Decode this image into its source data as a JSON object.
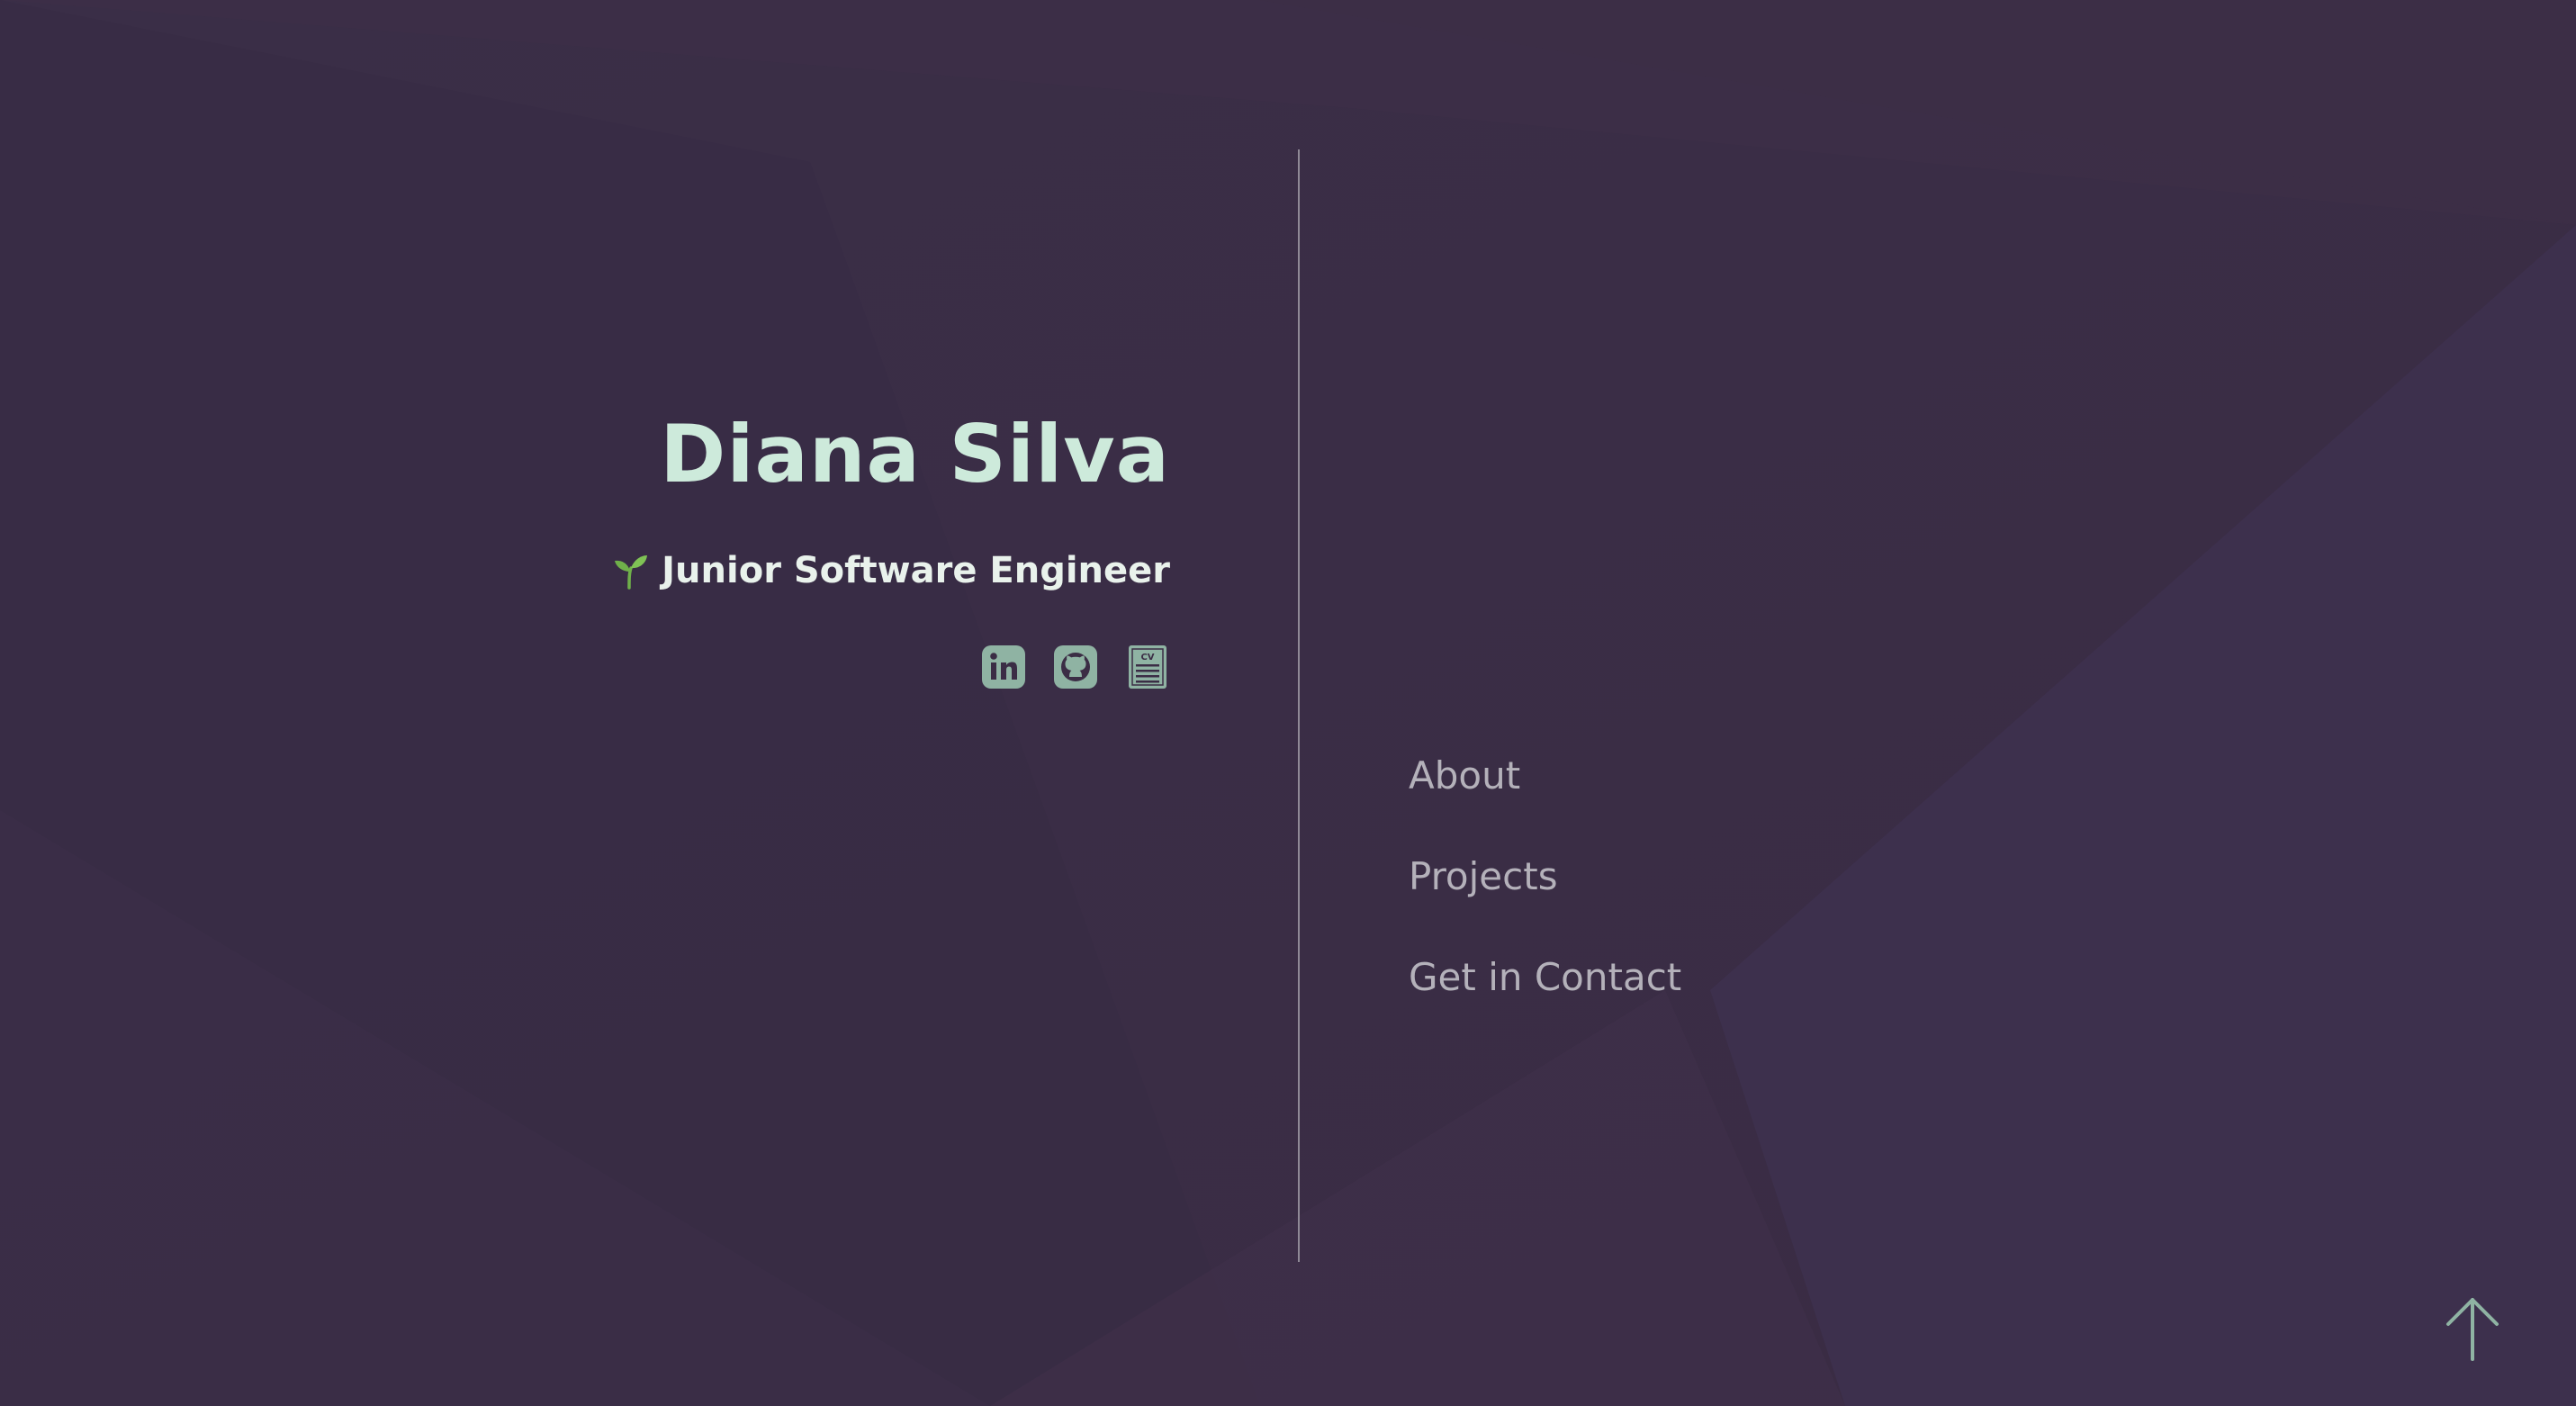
{
  "profile": {
    "name": "Diana Silva",
    "role": "Junior Software Engineer"
  },
  "socials": [
    {
      "icon": "linkedin-icon",
      "label": "in"
    },
    {
      "icon": "github-icon"
    },
    {
      "icon": "cv-icon",
      "label": "CV"
    }
  ],
  "nav": {
    "items": [
      {
        "label": "About"
      },
      {
        "label": "Projects"
      },
      {
        "label": "Get in Contact"
      }
    ]
  },
  "icons": {
    "role": "sprout-icon",
    "back_to_top": "arrow-up-icon"
  },
  "colors": {
    "background": "#3b2d45",
    "name": "#cdeadb",
    "role": "#e9f2ec",
    "icon": "#8fb3a3",
    "nav": "#b4b1ba",
    "divider": "#8f8996",
    "sprout": "#6fb04a"
  }
}
